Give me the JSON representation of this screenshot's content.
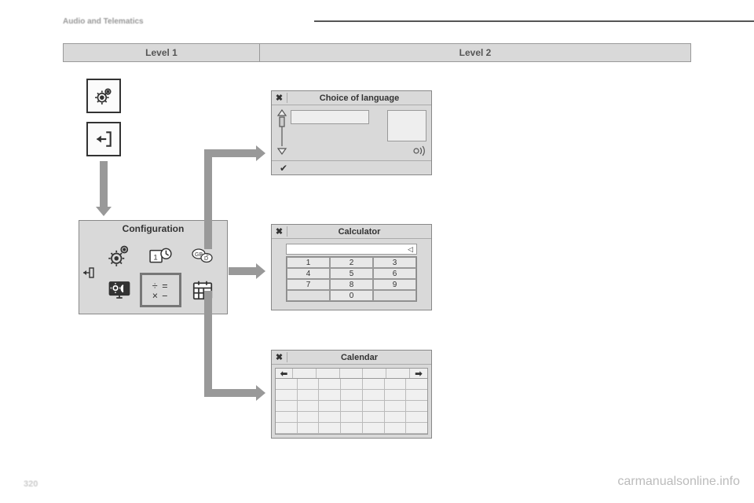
{
  "header": {
    "section_title": "Audio and Telematics",
    "page_number": "320"
  },
  "levels": {
    "col1": "Level 1",
    "col2": "Level 2"
  },
  "configuration": {
    "title": "Configuration"
  },
  "language_panel": {
    "close": "✖",
    "title": "Choice of language",
    "confirm": "✔"
  },
  "calculator_panel": {
    "close": "✖",
    "title": "Calculator",
    "display_indicator": "◁",
    "keys": [
      [
        "1",
        "2",
        "3"
      ],
      [
        "4",
        "5",
        "6"
      ],
      [
        "7",
        "8",
        "9"
      ],
      [
        "",
        "0",
        ""
      ]
    ]
  },
  "calendar_panel": {
    "close": "✖",
    "title": "Calendar",
    "prev": "⬅",
    "next": "➡"
  },
  "watermark": "carmanualsonline.info"
}
